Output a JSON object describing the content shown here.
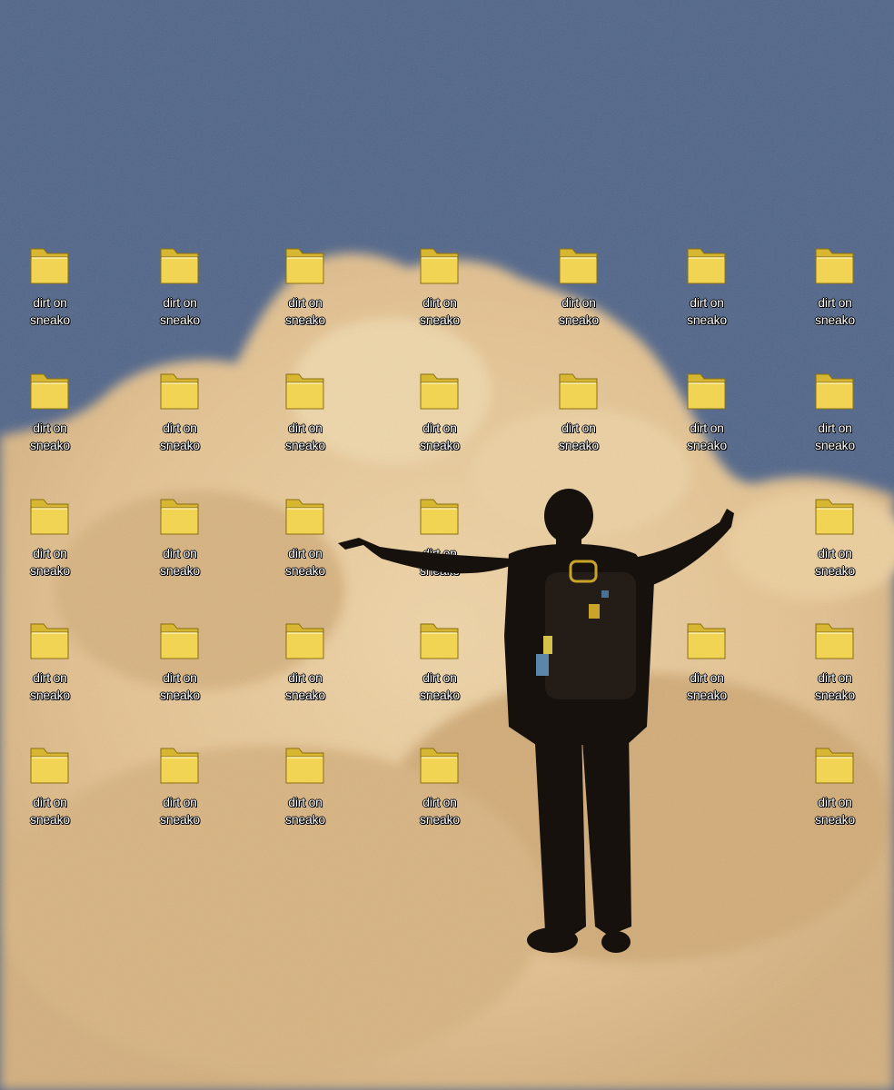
{
  "desktop": {
    "colors": {
      "sky": "#4f6488",
      "cloud": "#e8c896",
      "folder": "#f2d454",
      "silhouette": "#16110d"
    },
    "icon": {
      "name_line1": "dirt on",
      "name_line2": "sneako",
      "icon_type": "folder-icon"
    },
    "grid": {
      "rows": 5,
      "columns": 7,
      "hidden_cells": [
        [
          2,
          4
        ],
        [
          3,
          4
        ],
        [
          4,
          4
        ],
        [
          4,
          5
        ],
        [
          2,
          5
        ]
      ]
    }
  }
}
